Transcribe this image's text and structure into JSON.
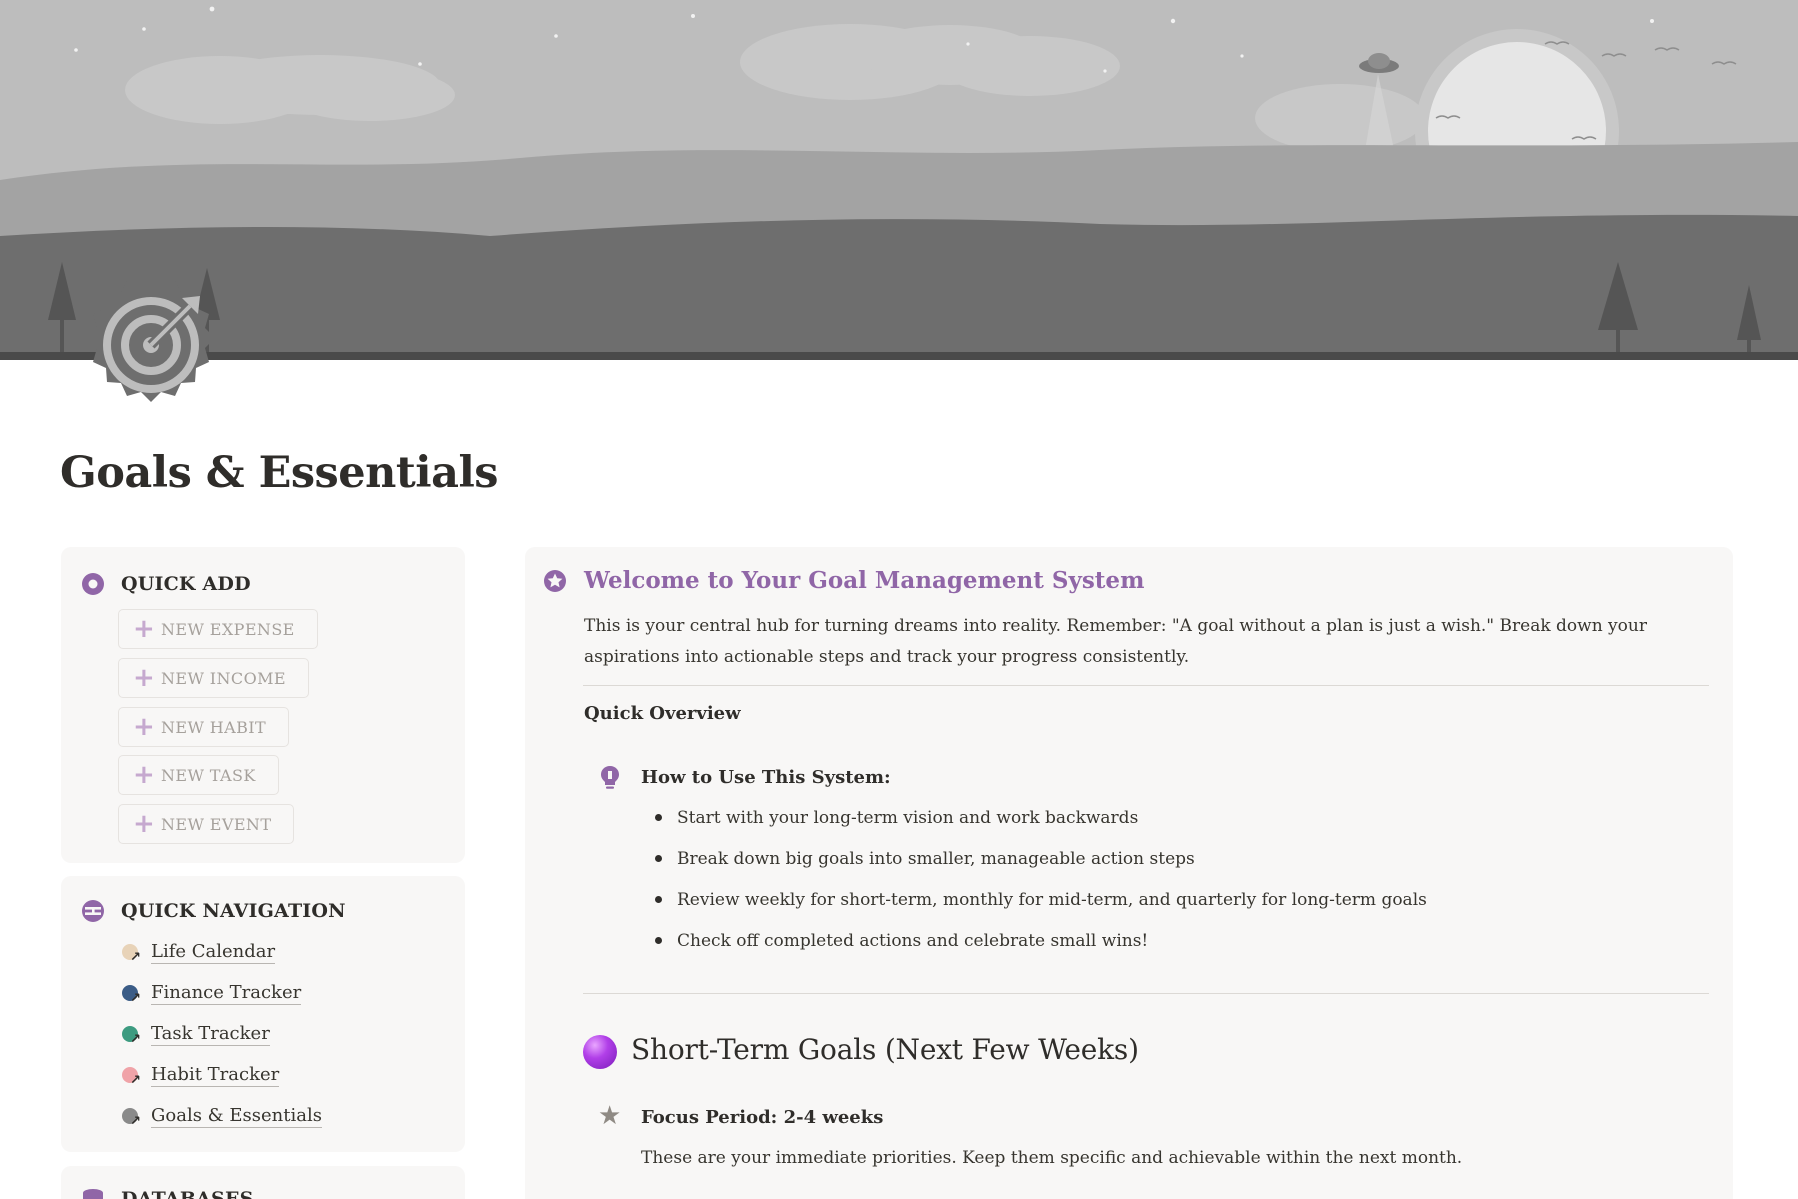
{
  "page": {
    "title": "Goals & Essentials",
    "icon": "target-badge-icon"
  },
  "colors": {
    "accent": "#9066a7",
    "banner_sky": "#bdbdbd",
    "banner_ground": "#6e6e6e",
    "card_bg": "#f8f7f6"
  },
  "quick_add": {
    "heading": "QUICK ADD",
    "icon": "radio-dot-icon",
    "buttons": [
      {
        "label": "NEW EXPENSE"
      },
      {
        "label": "NEW INCOME"
      },
      {
        "label": "NEW HABIT"
      },
      {
        "label": "NEW TASK"
      },
      {
        "label": "NEW EVENT"
      }
    ]
  },
  "quick_navigation": {
    "heading": "QUICK NAVIGATION",
    "icon": "split-circle-icon",
    "items": [
      {
        "label": "Life Calendar",
        "color": "#e8d3b8"
      },
      {
        "label": "Finance Tracker",
        "color": "#3b5c86"
      },
      {
        "label": "Task Tracker",
        "color": "#3d9b80"
      },
      {
        "label": "Habit Tracker",
        "color": "#f0a3a8"
      },
      {
        "label": "Goals & Essentials",
        "color": "#8a8a8a"
      }
    ]
  },
  "databases": {
    "heading": "DATABASES",
    "icon": "database-icon"
  },
  "welcome": {
    "icon": "star-badge-icon",
    "title": "Welcome to Your Goal Management System",
    "body": "This is your central hub for turning dreams into reality. Remember: \"A goal without a plan is just a wish.\" Break down your aspirations into actionable steps and track your progress consistently.",
    "overview_label": "Quick Overview",
    "how_to": {
      "icon": "lightbulb-icon",
      "label": "How to Use This System:",
      "bullets": [
        "Start with your long-term vision and work backwards",
        "Break down big goals into smaller, manageable action steps",
        "Review weekly for short-term, monthly for mid-term, and quarterly for long-term goals",
        "Check off completed actions and celebrate small wins!"
      ]
    }
  },
  "short_term": {
    "icon": "purple-orb-icon",
    "title": "Short-Term Goals (Next Few Weeks)",
    "focus_icon": "star-icon",
    "focus_label": "Focus Period: 2-4 weeks",
    "focus_body": "These are your immediate priorities. Keep them specific and achievable within the next month."
  }
}
